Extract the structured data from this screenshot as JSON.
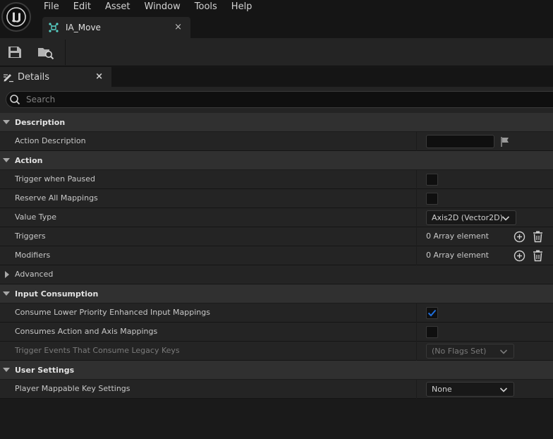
{
  "menu": [
    "File",
    "Edit",
    "Asset",
    "Window",
    "Tools",
    "Help"
  ],
  "document_tab": {
    "label": "IA_Move",
    "close": "×"
  },
  "toolbar": {
    "save": "save-icon",
    "browse": "browse-asset-icon"
  },
  "details_tab": {
    "label": "Details",
    "close": "×"
  },
  "search": {
    "placeholder": "Search",
    "value": ""
  },
  "categories": {
    "description": {
      "label": "Description",
      "action_description": {
        "label": "Action Description",
        "value": ""
      }
    },
    "action": {
      "label": "Action",
      "trigger_when_paused": {
        "label": "Trigger when Paused",
        "checked": false
      },
      "reserve_all_mappings": {
        "label": "Reserve All Mappings",
        "checked": false
      },
      "value_type": {
        "label": "Value Type",
        "value": "Axis2D (Vector2D)"
      },
      "triggers": {
        "label": "Triggers",
        "value": "0 Array element"
      },
      "modifiers": {
        "label": "Modifiers",
        "value": "0 Array element"
      },
      "advanced": {
        "label": "Advanced"
      }
    },
    "input_consumption": {
      "label": "Input Consumption",
      "consume_lower": {
        "label": "Consume Lower Priority Enhanced Input Mappings",
        "checked": true
      },
      "consumes_action_axis": {
        "label": "Consumes Action and Axis Mappings",
        "checked": false
      },
      "trigger_events_legacy": {
        "label": "Trigger Events That Consume Legacy Keys",
        "value": "(No Flags Set)"
      }
    },
    "user_settings": {
      "label": "User Settings",
      "player_mappable": {
        "label": "Player Mappable Key Settings",
        "value": "None"
      }
    }
  },
  "colors": {
    "accent": "#1f6fdc",
    "panel": "#242424",
    "category": "#303030"
  }
}
